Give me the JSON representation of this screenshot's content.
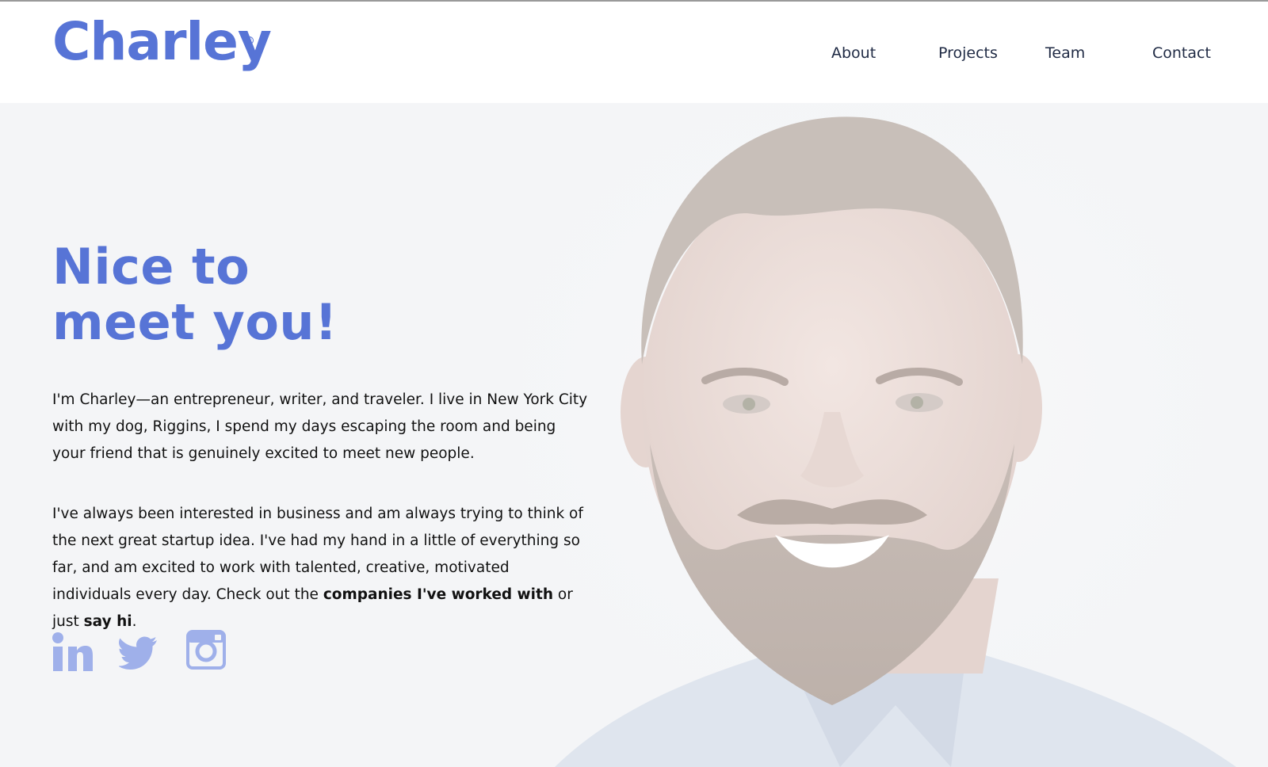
{
  "brand": {
    "logo_text": "Charley",
    "registered_mark": "®",
    "accent_color": "#5774d6"
  },
  "nav": {
    "about": "About",
    "projects": "Projects",
    "team": "Team",
    "contact": "Contact"
  },
  "hero": {
    "heading_line1": "Nice to",
    "heading_line2": "meet you!",
    "para1": "I'm Charley—an entrepreneur, writer, and traveler. I live in New York City with my dog, Riggins, I spend my days escaping the room and being your friend that is genuinely excited to meet new people.",
    "para2_start": "I've always been interested in business and am always trying to think of the next great startup idea. I've had my hand in a little of everything so far, and am excited to work with talented, creative, motivated individuals every day. Check out the ",
    "para2_link1": "companies I've worked with",
    "para2_mid": " or just ",
    "para2_link2": "say hi",
    "para2_end": "."
  },
  "social": {
    "icons": [
      "linkedin-icon",
      "twitter-icon",
      "instagram-icon"
    ],
    "icon_color": "#9fb0ea"
  },
  "portrait": {
    "icon": "portrait-photo"
  }
}
